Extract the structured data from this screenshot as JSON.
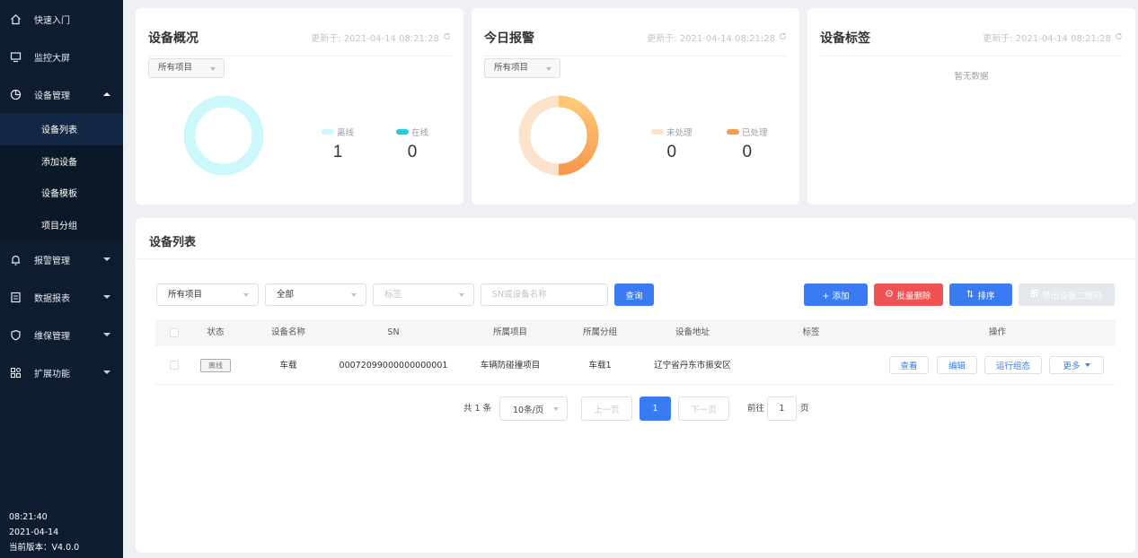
{
  "sidebar": {
    "items": [
      {
        "label": "快速入门",
        "icon": "home-icon"
      },
      {
        "label": "监控大屏",
        "icon": "monitor-icon"
      },
      {
        "label": "设备管理",
        "icon": "pie-icon"
      },
      {
        "label": "报警管理",
        "icon": "bell-icon"
      },
      {
        "label": "数据报表",
        "icon": "report-icon"
      },
      {
        "label": "维保管理",
        "icon": "shield-icon"
      },
      {
        "label": "扩展功能",
        "icon": "apps-icon"
      }
    ],
    "sub_items": [
      "设备列表",
      "添加设备",
      "设备模板",
      "项目分组"
    ],
    "time": "08:21:40",
    "date": "2021-04-14",
    "version": "当前版本：V4.0.0"
  },
  "overview": {
    "title": "设备概况",
    "updated": "更新于: 2021-04-14 08:21:28",
    "select": "所有项目",
    "legend": [
      {
        "label": "离线",
        "value": "1",
        "color": "#ccf7fb"
      },
      {
        "label": "在线",
        "value": "0",
        "color": "#1fcfe0"
      }
    ]
  },
  "alarm": {
    "title": "今日报警",
    "updated": "更新于: 2021-04-14 08:21:28",
    "select": "所有项目",
    "legend": [
      {
        "label": "未处理",
        "value": "0",
        "color": "#fde3cc"
      },
      {
        "label": "已处理",
        "value": "0",
        "color": "#f79a4e"
      }
    ]
  },
  "tags": {
    "title": "设备标签",
    "updated": "更新于: 2021-04-14 08:21:28",
    "empty": "暂无数据"
  },
  "list": {
    "title": "设备列表",
    "filters": {
      "project": "所有项目",
      "status": "全部",
      "tag_placeholder": "标签",
      "search_placeholder": "SN或设备名称",
      "query": "查询"
    },
    "actions": {
      "add": "+ 添加",
      "batch_delete": "批量删除",
      "sort": "排序",
      "export": "导出设备二维码"
    },
    "columns": [
      "状态",
      "设备名称",
      "SN",
      "所属项目",
      "所属分组",
      "设备地址",
      "标签",
      "操作"
    ],
    "rows": [
      {
        "status": "离线",
        "name": "车载",
        "sn": "00072099000000000001",
        "project": "车辆防碰撞项目",
        "group": "车载1",
        "address": "辽宁省丹东市振安区",
        "tag": "",
        "ops": [
          "查看",
          "编辑",
          "运行组态",
          "更多"
        ]
      }
    ],
    "pagination": {
      "total": "共 1 条",
      "page_size": "10条/页",
      "prev": "上一页",
      "current": "1",
      "next": "下一页",
      "goto_prefix": "前往",
      "goto_value": "1",
      "goto_suffix": "页"
    }
  }
}
